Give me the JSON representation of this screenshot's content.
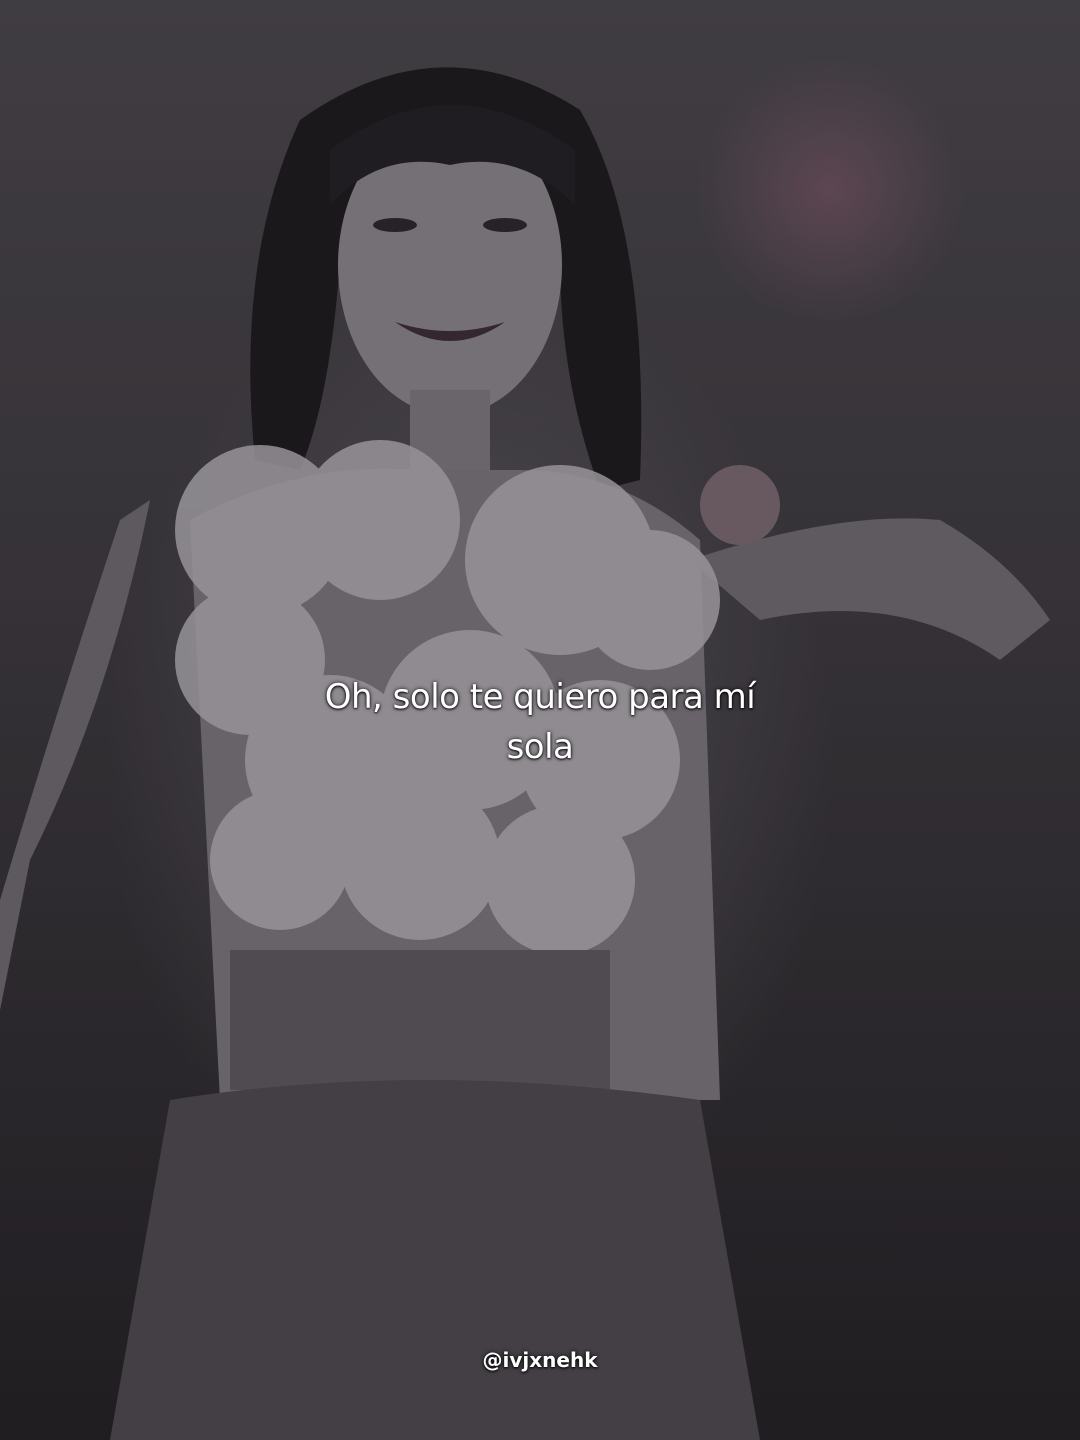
{
  "caption": {
    "line1": "Oh, solo te quiero para mí",
    "line2": "sola"
  },
  "watermark": {
    "handle": "@ivjxnehk"
  },
  "colors": {
    "text": "#ffffff",
    "background": "#2a282b"
  }
}
